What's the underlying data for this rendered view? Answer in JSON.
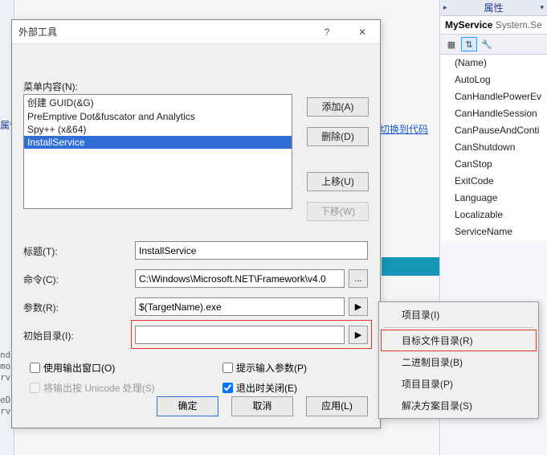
{
  "bg": {
    "leftLabel": "属性",
    "codeLines": [
      "nd",
      "mo",
      "rv:",
      "",
      "eDes",
      "rvi"
    ],
    "switchLink": "切换到代码"
  },
  "propPanel": {
    "headerTitle": "属性",
    "objectName": "MyService",
    "objectType": "System.Se",
    "toolbar": [
      "▦",
      "⇅",
      "🔧"
    ],
    "rows": [
      "(Name)",
      "AutoLog",
      "CanHandlePowerEv",
      "CanHandleSession",
      "CanPauseAndConti",
      "CanShutdown",
      "CanStop",
      "ExitCode",
      "Language",
      "Localizable",
      "ServiceName"
    ]
  },
  "tealStrip": {
    "pin": "📌",
    "close": "✕",
    "arrow": "▾"
  },
  "dialog": {
    "title": "外部工具",
    "menuLabel": "菜单内容(N):",
    "listItems": [
      "创建 GUID(&G)",
      "PreEmptive Dot&fuscator and Analytics",
      "Spy++ (x&64)",
      "InstallService"
    ],
    "selectedIndex": 3,
    "sideButtons": {
      "add": "添加(A)",
      "delete": "删除(D)",
      "moveUp": "上移(U)",
      "moveDown": "下移(W)"
    },
    "fields": {
      "title": {
        "label": "标题(T):",
        "value": "InstallService"
      },
      "command": {
        "label": "命令(C):",
        "value": "C:\\Windows\\Microsoft.NET\\Framework\\v4.0"
      },
      "args": {
        "label": "参数(R):",
        "value": "$(TargetName).exe"
      },
      "initDir": {
        "label": "初始目录(I):",
        "value": ""
      }
    },
    "ellipsis": "...",
    "arrow": "▶",
    "checkboxes": {
      "useOutput": "使用输出窗口(O)",
      "promptArgs": "提示输入参数(P)",
      "unicode": "将输出按 Unicode 处理(S)",
      "closeOnExit": "退出时关闭(E)"
    },
    "checked": {
      "closeOnExit": true
    },
    "mainButtons": {
      "ok": "确定",
      "cancel": "取消",
      "apply": "应用(L)"
    },
    "helpGlyph": "?",
    "closeGlyph": "✕"
  },
  "contextMenu": {
    "items": [
      {
        "label": "项目录(I)"
      },
      {
        "label": "目标文件目录(R)",
        "highlight": true
      },
      {
        "label": "二进制目录(B)"
      },
      {
        "label": "项目目录(P)"
      },
      {
        "label": "解决方案目录(S)"
      }
    ],
    "sepAfter": 0
  }
}
